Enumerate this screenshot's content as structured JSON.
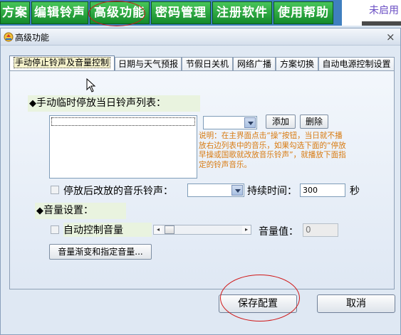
{
  "top_menu": {
    "items": [
      "方案",
      "编辑铃声",
      "高级功能",
      "密码管理",
      "注册软件",
      "使用帮助"
    ],
    "right_text": "未启用"
  },
  "dialog": {
    "title": "高级功能",
    "close": "×",
    "tabs": [
      "手动停止铃声及音量控制",
      "日期与天气预报",
      "节假日关机",
      "网络广播",
      "方案切换",
      "自动电源控制设置"
    ],
    "manual": {
      "section_label": "手动临时停放当日铃声列表：",
      "bullet": "◆",
      "add_button": "添加",
      "delete_button": "删除",
      "note": "说明：在主界面点击“操”按钮，当日就不播放右边列表中的音乐，如果勾选下面的“停放早操或国歌就改放音乐铃声”，就播放下面指定的铃声音乐。",
      "after_stop_label": "停放后改放的音乐铃声：",
      "duration_label": "持续时间：",
      "duration_value": "300",
      "seconds_unit": "秒"
    },
    "volume": {
      "section_label": "音量设置：",
      "bullet": "◆",
      "auto_label": "自动控制音量",
      "value_label": "音量值：",
      "value": "0",
      "fade_button": "音量渐变和指定音量...",
      "slider_left": "◂",
      "slider_right": "▸"
    },
    "save_button": "保存配置",
    "cancel_button": "取消"
  },
  "colors": {
    "menu_green": "#148a2b",
    "accent_red": "#d01818",
    "note_orange": "#d87a10",
    "topbar_blue": "#3f7fbf"
  }
}
